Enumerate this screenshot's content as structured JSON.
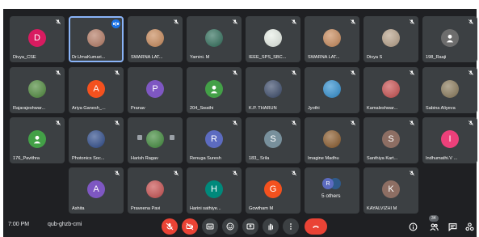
{
  "meeting": {
    "time": "7:00 PM",
    "code": "qub-ghzb-cmi"
  },
  "participants": [
    {
      "name": "Divya_CSE",
      "avatar": "letter",
      "initial": "D",
      "color": "#d81b60",
      "muted": true
    },
    {
      "name": "Dr.UmaKumari...",
      "avatar": "photo",
      "color": "#b57b64",
      "speaking": true
    },
    {
      "name": "SWARNA LAT...",
      "avatar": "photo",
      "color": "#c98a5a",
      "muted": true
    },
    {
      "name": "Yamini. M",
      "avatar": "photo",
      "color": "#2f6e5a",
      "muted": true
    },
    {
      "name": "IEEE_SPS_SBC...",
      "avatar": "photo",
      "color": "#e8efe7",
      "muted": true
    },
    {
      "name": "SWARNA LAT...",
      "avatar": "photo",
      "color": "#c98a5a",
      "muted": true
    },
    {
      "name": "Divya S",
      "avatar": "photo",
      "color": "#b8a28a",
      "muted": true
    },
    {
      "name": "198_Raaji",
      "avatar": "person",
      "color": "#6d6d6d",
      "muted": true
    },
    {
      "name": "Rajarajeshwar...",
      "avatar": "photo",
      "color": "#4d8a3a",
      "muted": true
    },
    {
      "name": "Ariya Ganesh_...",
      "avatar": "letter",
      "initial": "A",
      "color": "#f4511e",
      "muted": true
    },
    {
      "name": "Pranav",
      "avatar": "letter",
      "initial": "P",
      "color": "#7e57c2",
      "muted": false
    },
    {
      "name": "204_Swathi",
      "avatar": "person",
      "color": "#43a047",
      "muted": true
    },
    {
      "name": "K.P. THARUN",
      "avatar": "photo",
      "color": "#3a4a6a",
      "muted": true
    },
    {
      "name": "Jyothi",
      "avatar": "photo",
      "color": "#2f8fd0",
      "muted": true
    },
    {
      "name": "Kamaleshwar...",
      "avatar": "photo",
      "color": "#c94f4f",
      "muted": true
    },
    {
      "name": "Sabina Aliyeva",
      "avatar": "photo",
      "color": "#8a7a5a",
      "muted": true
    },
    {
      "name": "176_Pavithra",
      "avatar": "person",
      "color": "#43a047",
      "muted": true
    },
    {
      "name": "Photonics Soc...",
      "avatar": "photo",
      "color": "#2c4a8a",
      "muted": true
    },
    {
      "name": "Harish Ragav",
      "avatar": "photo",
      "color": "#3f8a3a",
      "muted": false,
      "hover": true
    },
    {
      "name": "Renuga Suresh",
      "avatar": "letter",
      "initial": "R",
      "color": "#5c6bc0",
      "muted": true
    },
    {
      "name": "183_ Srila",
      "avatar": "letter",
      "initial": "S",
      "color": "#78909c",
      "muted": true
    },
    {
      "name": "Imagine Madhu",
      "avatar": "photo",
      "color": "#8a5a2a",
      "muted": true
    },
    {
      "name": "Santhiya Kart...",
      "avatar": "letter",
      "initial": "S",
      "color": "#8d6e63",
      "muted": true
    },
    {
      "name": "Indhumathi.V ...",
      "avatar": "letter",
      "initial": "I",
      "color": "#ec407a",
      "muted": true
    },
    {
      "name": "Ashita",
      "avatar": "letter",
      "initial": "A",
      "color": "#7e57c2",
      "muted": true
    },
    {
      "name": "Praveena Pavi",
      "avatar": "photo",
      "color": "#c94f4f",
      "muted": true
    },
    {
      "name": "Harini sathiye...",
      "avatar": "letter",
      "initial": "H",
      "color": "#00897b",
      "muted": true
    },
    {
      "name": "Gowtham M",
      "avatar": "letter",
      "initial": "G",
      "color": "#f4511e",
      "muted": true
    },
    {
      "name": "5 others",
      "avatar": "others",
      "muted": false
    },
    {
      "name": "KAYALVIZHI M",
      "avatar": "letter",
      "initial": "K",
      "color": "#8d6e63",
      "muted": true
    }
  ],
  "others_initial": "R",
  "people_count": "34",
  "colors": {
    "stage": "#1f2023",
    "tile": "#3c4043",
    "danger": "#ea4335",
    "accent": "#8ab4f8"
  },
  "controls": [
    "mic-off",
    "camera-off",
    "captions",
    "emoji",
    "present",
    "raise-hand",
    "more",
    "end-call"
  ],
  "right_controls": [
    "info",
    "people",
    "chat",
    "activities"
  ]
}
